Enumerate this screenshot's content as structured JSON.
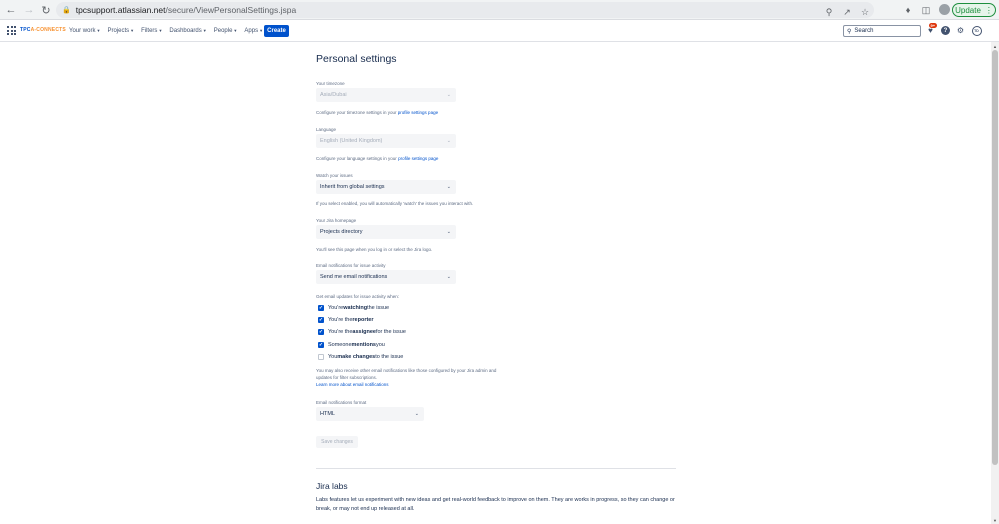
{
  "browser": {
    "url_host": "tpcsupport.atlassian.net",
    "url_path": "/secure/ViewPersonalSettings.jspa",
    "update_label": "Update"
  },
  "header": {
    "logo_text_a": "TPC",
    "logo_text_b": "A-CONNECTS",
    "menu": [
      {
        "label": "Your work"
      },
      {
        "label": "Projects"
      },
      {
        "label": "Filters"
      },
      {
        "label": "Dashboards"
      },
      {
        "label": "People"
      },
      {
        "label": "Apps"
      }
    ],
    "create_label": "Create",
    "search_placeholder": "Search",
    "notif_count": "9+",
    "user_initials": "TD"
  },
  "page": {
    "title": "Personal settings",
    "timezone": {
      "label": "Your timezone",
      "value": "Asia/Dubai",
      "help_prefix": "Configure your timezone settings in your ",
      "help_link": "profile settings page"
    },
    "language": {
      "label": "Language",
      "value": "English (United Kingdom)",
      "help_prefix": "Configure your language settings in your ",
      "help_link": "profile settings page"
    },
    "watch": {
      "label": "Watch your issues",
      "value": "Inherit from global settings",
      "help": "If you select enabled, you will automatically 'watch' the issues you interact with."
    },
    "homepage": {
      "label": "Your Jira homepage",
      "value": "Projects directory",
      "help": "You'll see this page when you log in or select the Jira logo."
    },
    "email_activity": {
      "label": "Email notifications for issue activity",
      "value": "Send me email notifications"
    },
    "updates_label": "Get email updates for issue activity when:",
    "checks": [
      {
        "pre": "You're ",
        "bold": "watching",
        "post": " the issue",
        "checked": true
      },
      {
        "pre": "You're the ",
        "bold": "reporter",
        "post": "",
        "checked": true
      },
      {
        "pre": "You're the ",
        "bold": "assignee",
        "post": " for the issue",
        "checked": true
      },
      {
        "pre": "Someone ",
        "bold": "mentions",
        "post": " you",
        "checked": true
      },
      {
        "pre": "You ",
        "bold": "make changes",
        "post": " to the issue",
        "checked": false
      }
    ],
    "other_notif_line1": "You may also receive other email notifications like those configured by your Jira admin and",
    "other_notif_line2": "updates for filter subscriptions.",
    "learn_more": "Learn more about email notifications",
    "format": {
      "label": "Email notifications format",
      "value": "HTML"
    },
    "save_label": "Save changes",
    "labs": {
      "title": "Jira labs",
      "text": "Labs features let us experiment with new ideas and get real-world feedback to improve on them. They are works in progress, so they can change or break, or may not end up released at all."
    }
  },
  "colors": {
    "brand_blue": "#0052cc",
    "update_green": "#1e8e3e",
    "badge_red": "#de350b"
  }
}
